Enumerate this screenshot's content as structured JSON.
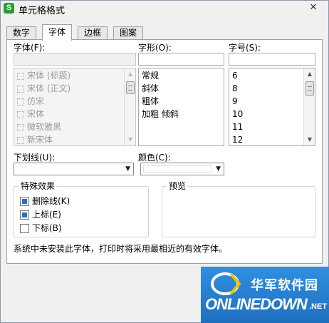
{
  "window": {
    "title": "单元格格式",
    "app_icon_glyph": "S",
    "close_glyph": "✕"
  },
  "tabs": [
    {
      "label": "数字",
      "active": false
    },
    {
      "label": "字体",
      "active": true
    },
    {
      "label": "边框",
      "active": false
    },
    {
      "label": "图案",
      "active": false
    }
  ],
  "font": {
    "label": "字体(F):",
    "value": "",
    "items": [
      "宋体 (标题)",
      "宋体 (正文)",
      "仿宋",
      "宋体",
      "微软雅黑",
      "新宋体"
    ]
  },
  "style": {
    "label": "字形(O):",
    "value": "",
    "items": [
      "常规",
      "斜体",
      "粗体",
      "加粗 倾斜"
    ]
  },
  "size": {
    "label": "字号(S):",
    "value": "",
    "items": [
      "6",
      "8",
      "9",
      "10",
      "11",
      "12"
    ]
  },
  "underline": {
    "label": "下划线(U):",
    "value": ""
  },
  "color": {
    "label": "颜色(C):"
  },
  "effects": {
    "title": "特殊效果",
    "items": [
      {
        "label": "删除线(K)",
        "state": "indeterminate"
      },
      {
        "label": "上标(E)",
        "state": "indeterminate"
      },
      {
        "label": "下标(B)",
        "state": "unchecked"
      }
    ]
  },
  "preview": {
    "title": "预览"
  },
  "note": "系统中未安装此字体，打印时将采用最相近的有效字体。",
  "watermark": {
    "cn": "华军软件园",
    "en": "ONLINEDOWN",
    "net": ".NET"
  },
  "icons": {
    "scroll_up": "▲",
    "scroll_down": "▼",
    "dropdown_arrow": "▼"
  }
}
